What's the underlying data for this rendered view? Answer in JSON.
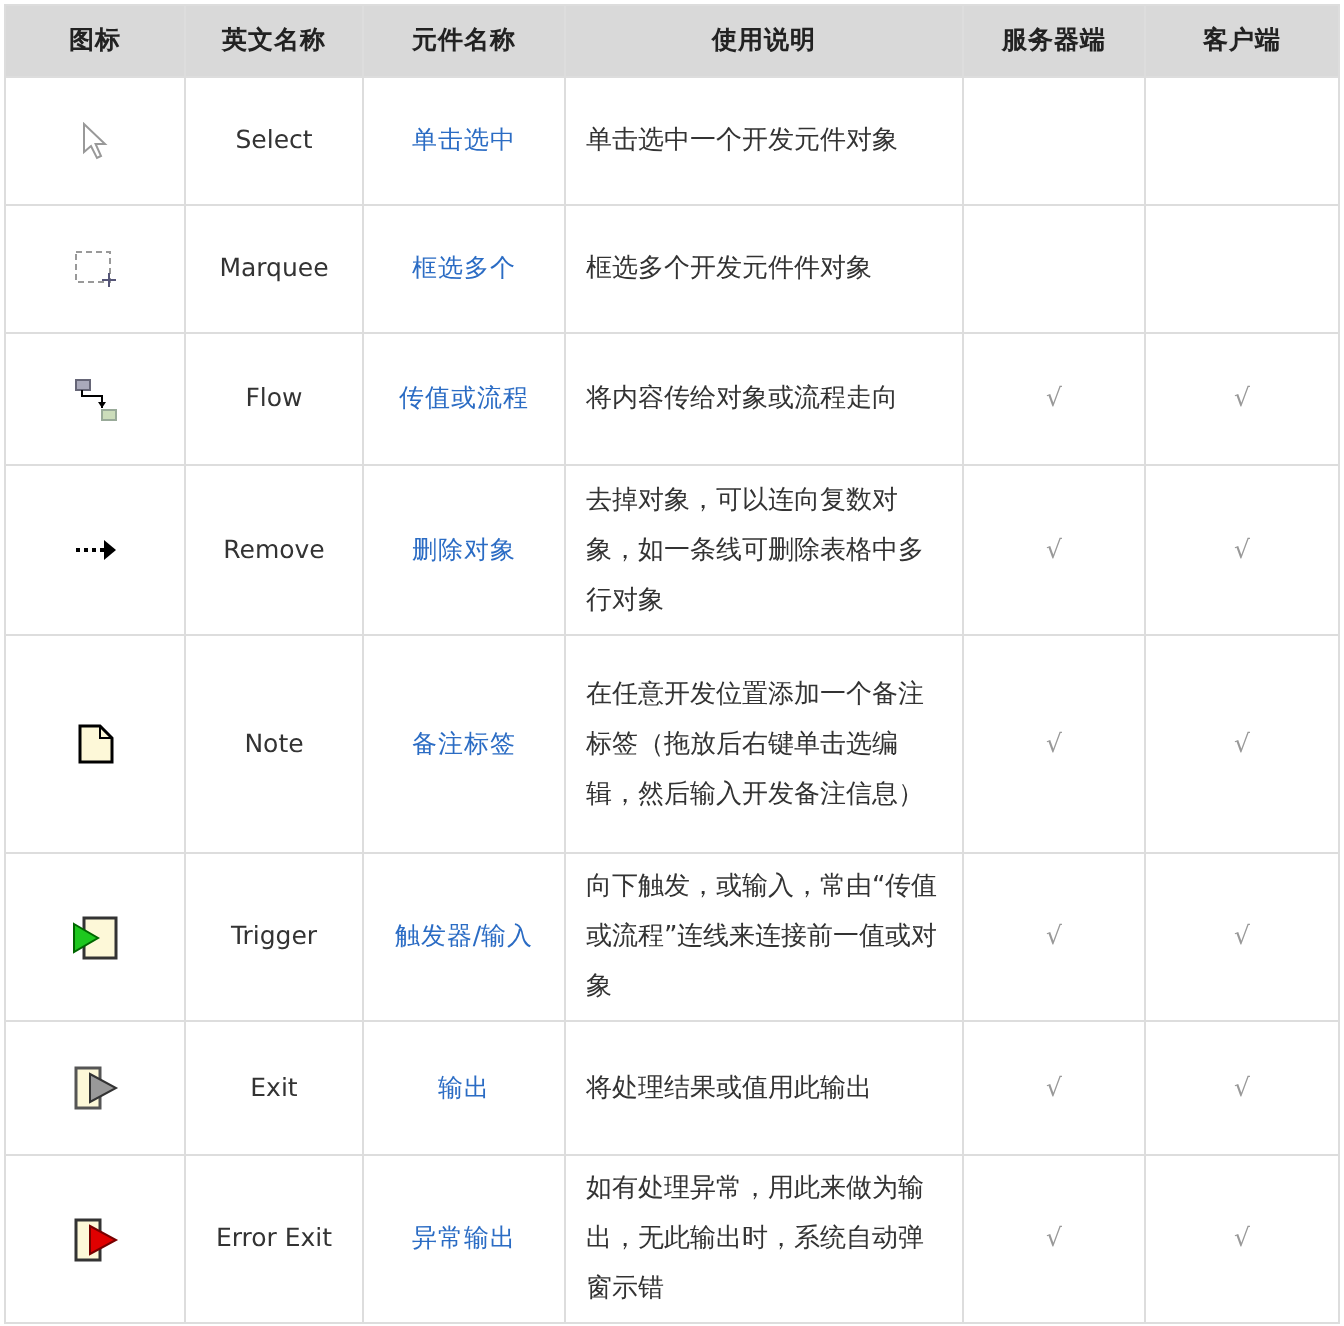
{
  "table": {
    "columns": [
      "图标",
      "英文名称",
      "元件名称",
      "使用说明",
      "服务器端",
      "客户端"
    ],
    "rows": [
      {
        "kind": "pointer",
        "english": "Select",
        "name": "单击选中",
        "usage": "单击选中一个开发元件对象"
      },
      {
        "kind": "marquee",
        "english": "Marquee",
        "name": "框选多个",
        "usage": "框选多个开发元件件对象"
      },
      {
        "kind": "flow",
        "english": "Flow",
        "name": "传值或流程",
        "usage": "将内容传给对象或流程走向",
        "server": "√",
        "client": "√"
      },
      {
        "kind": "arrow",
        "english": "Remove",
        "name": "删除对象",
        "usage": "去掉对象，可以连向复数对象，如一条线可删除表格中多行对象",
        "server": "√",
        "client": "√"
      },
      {
        "kind": "note",
        "english": "Note",
        "name": "备注标签",
        "usage": "在任意开发位置添加一个备注标签（拖放后右键单击选编辑，然后输入开发备注信息）",
        "server": "√",
        "client": "√"
      },
      {
        "kind": "trigger",
        "english": "Trigger",
        "name": "触发器/输入",
        "usage": "向下触发，或输入，常由“传值或流程”连线来连接前一值或对象",
        "server": "√",
        "client": "√"
      },
      {
        "kind": "exit",
        "english": "Exit",
        "name": "输出",
        "usage": "将处理结果或值用此输出",
        "server": "√",
        "client": "√"
      },
      {
        "kind": "error-exit",
        "english": "Error Exit",
        "name": "异常输出",
        "usage": "如有处理异常，用此来做为输出，无此输出时，系统自动弹窗示错",
        "server": "√",
        "client": "√"
      }
    ]
  }
}
